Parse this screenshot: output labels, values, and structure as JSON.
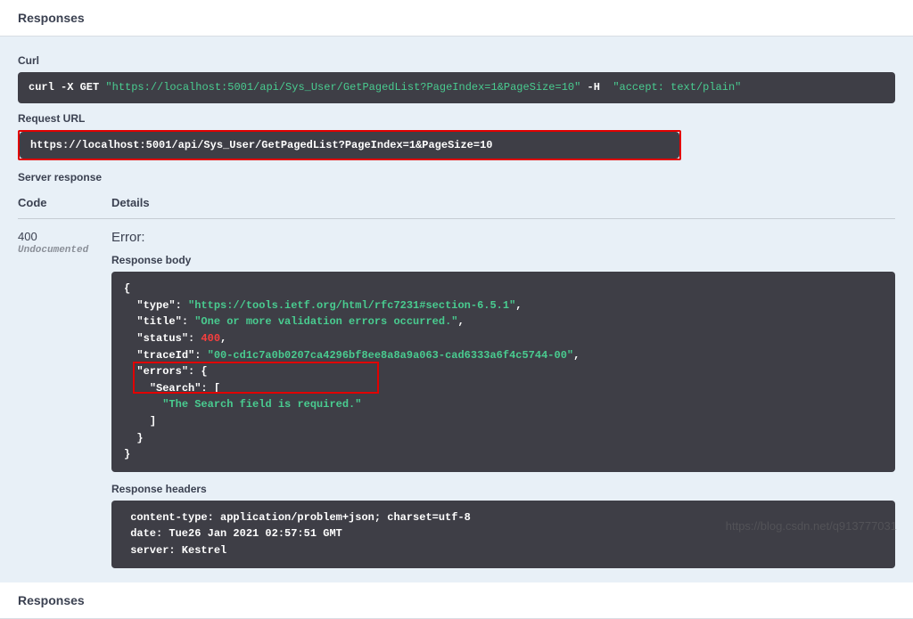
{
  "sections": {
    "responses_top": "Responses",
    "responses_bottom": "Responses"
  },
  "curl": {
    "label": "Curl",
    "cmd_prefix": "curl -X GET ",
    "url": "\"https://localhost:5001/api/Sys_User/GetPagedList?PageIndex=1&PageSize=10\"",
    "header_flag": " -H ",
    "header_val": " \"accept: text/plain\""
  },
  "request_url": {
    "label": "Request URL",
    "value": "https://localhost:5001/api/Sys_User/GetPagedList?PageIndex=1&PageSize=10"
  },
  "server_response": {
    "label": "Server response",
    "col_code": "Code",
    "col_details": "Details",
    "code": "400",
    "undocumented": "Undocumented",
    "error_label": "Error:",
    "body_label": "Response body",
    "body": {
      "open": "{",
      "type_key": "\"type\": ",
      "type_val": "\"https://tools.ietf.org/html/rfc7231#section-6.5.1\"",
      "title_key": "\"title\": ",
      "title_val": "\"One or more validation errors occurred.\"",
      "status_key": "\"status\": ",
      "status_val": "400",
      "traceid_key": "\"traceId\": ",
      "traceid_val": "\"00-cd1c7a0b0207ca4296bf8ee8a8a9a063-cad6333a6f4c5744-00\"",
      "errors_key": "\"errors\": {",
      "search_key": "\"Search\": [",
      "search_msg": "\"The Search field is required.\"",
      "close_arr": "]",
      "close_err": "}",
      "close": "}"
    },
    "headers_label": "Response headers",
    "headers": {
      "content_type": " content-type: application/problem+json; charset=utf-8 ",
      "date": " date: Tue26 Jan 2021 02:57:51 GMT ",
      "server": " server: Kestrel "
    }
  },
  "watermark": "https://blog.csdn.net/q913777031"
}
